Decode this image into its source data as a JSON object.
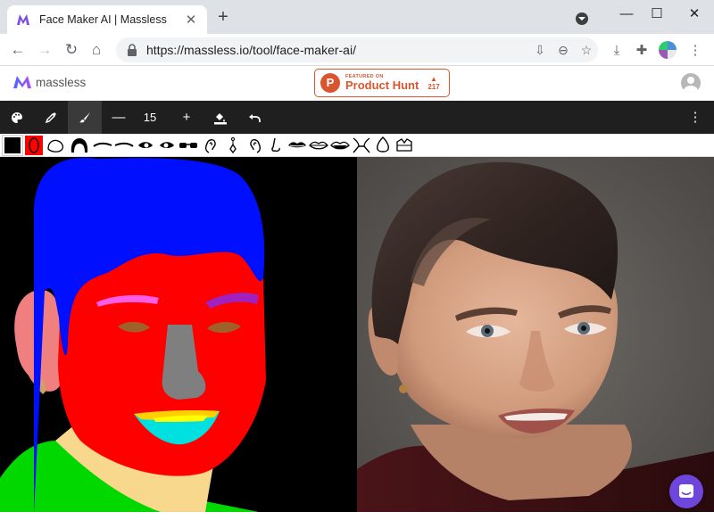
{
  "browser": {
    "tab_title": "Face Maker AI | Massless",
    "tab_close": "✕",
    "new_tab": "+",
    "url": "https://massless.io/tool/face-maker-ai/",
    "window_minimize": "—",
    "window_maximize": "☐",
    "window_close": "✕"
  },
  "site": {
    "logo_text": "massless",
    "product_hunt": {
      "featured": "FEATURED ON",
      "name": "Product Hunt",
      "letter": "P",
      "votes": "217"
    }
  },
  "drawing_toolbar": {
    "brush_size": "15",
    "minus": "—",
    "plus": "+"
  },
  "palette": {
    "selected_color": "#ff0000",
    "colors": [
      "#000000",
      "#ff0000"
    ]
  },
  "colors": {
    "accent": "#da552f",
    "chat": "#6e46dc",
    "toolbar": "#1f1f1f"
  }
}
